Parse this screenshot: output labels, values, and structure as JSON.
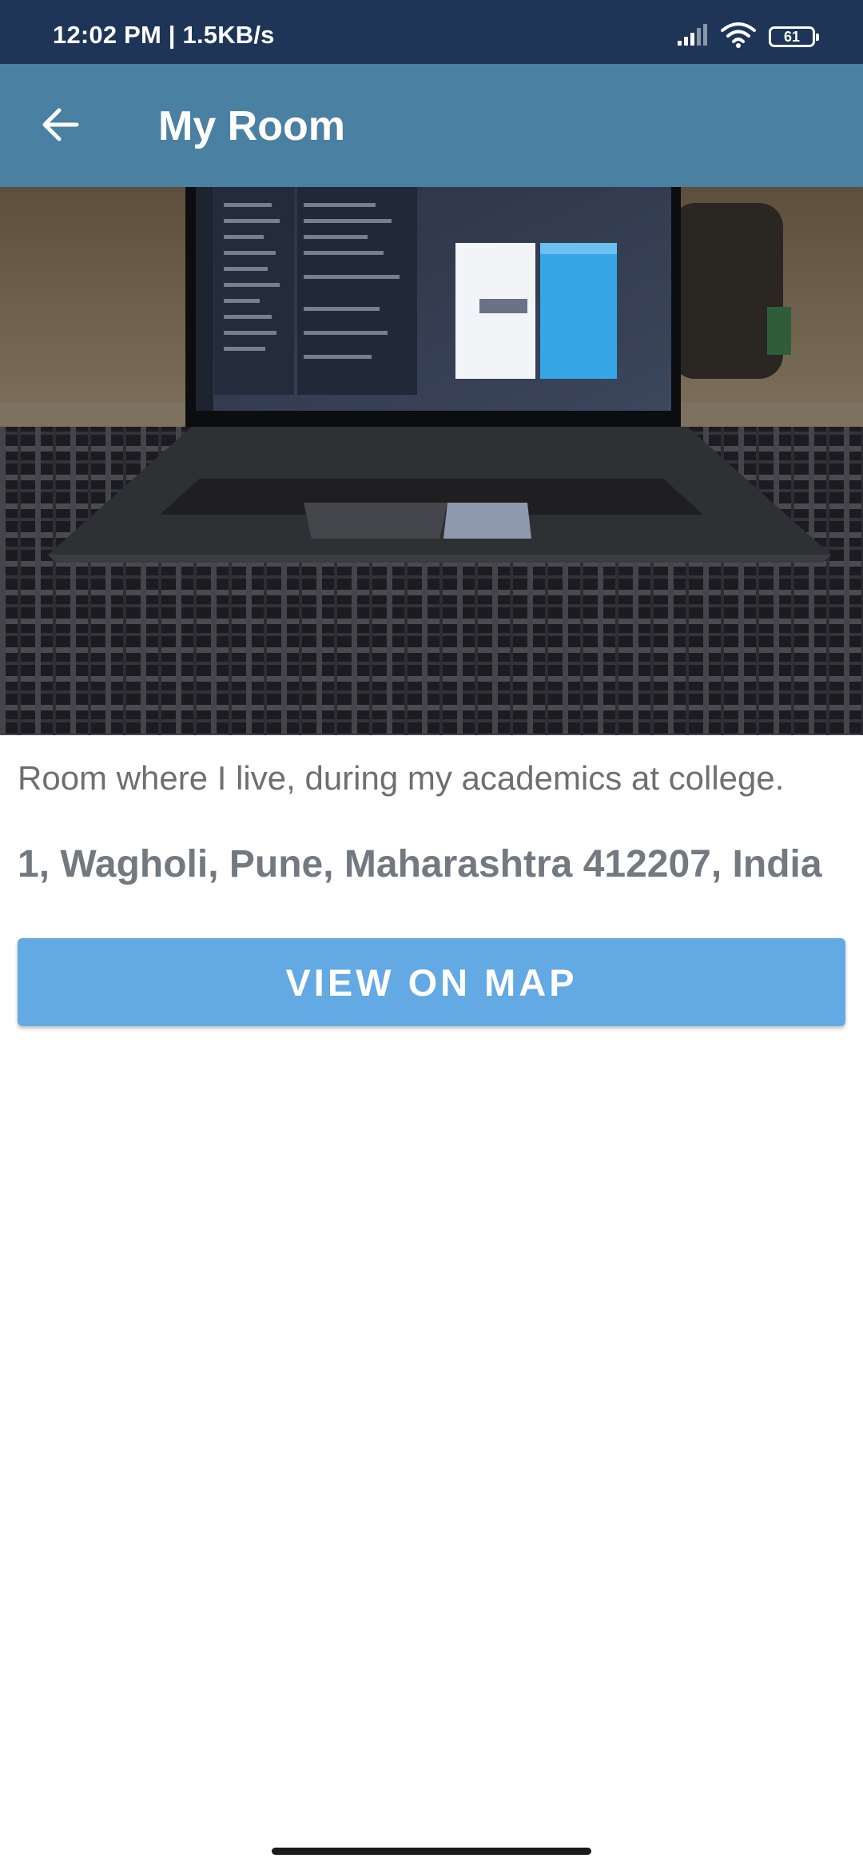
{
  "status_bar": {
    "time_speed": "12:02 PM | 1.5KB/s",
    "battery_level": "61",
    "icons": [
      "signal-icon",
      "wifi-icon",
      "battery-icon"
    ]
  },
  "app_bar": {
    "title": "My Room",
    "back_icon": "arrow-left-icon"
  },
  "place": {
    "image": "photo of a laptop on a desk",
    "description": "Room where I live, during my academics at college.",
    "address": "1, Wagholi, Pune, Maharashtra 412207, India"
  },
  "actions": {
    "view_on_map_label": "VIEW ON MAP"
  },
  "colors": {
    "status_bar": "#1e3558",
    "app_bar": "#4a80a2",
    "button": "#63a9e3",
    "description_text": "#6f6f6f",
    "address_text": "#737980"
  }
}
